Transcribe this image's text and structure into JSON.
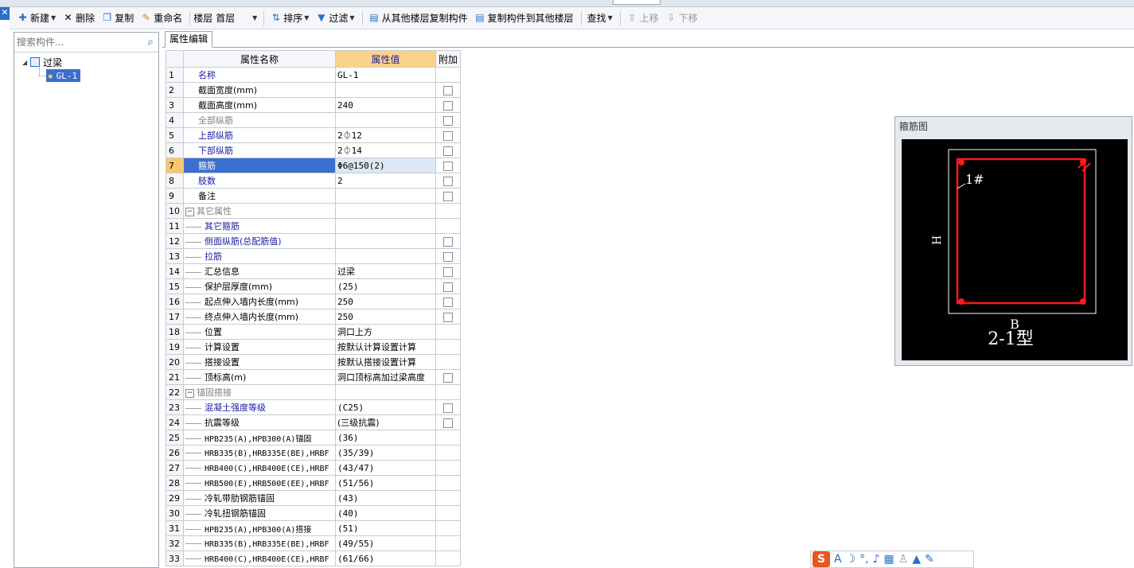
{
  "toolbar": {
    "new_label": "新建",
    "delete_label": "删除",
    "copy_label": "复制",
    "rename_label": "重命名",
    "floor_label": "楼层",
    "floor_value": "首层",
    "sort_label": "排序",
    "filter_label": "过滤",
    "copy_from_floor_label": "从其他楼层复制构件",
    "copy_to_floor_label": "复制构件到其他楼层",
    "find_label": "查找",
    "move_up_label": "上移",
    "move_down_label": "下移"
  },
  "tree": {
    "search_placeholder": "搜索构件...",
    "root_label": "过梁",
    "child_label": "GL-1"
  },
  "panel": {
    "tab_label": "属性编辑",
    "col_name": "属性名称",
    "col_value": "属性值",
    "col_extra": "附加"
  },
  "rows": [
    {
      "n": "1",
      "name": "名称",
      "value": "GL-1"
    },
    {
      "n": "2",
      "name": "截面宽度(mm)",
      "value": ""
    },
    {
      "n": "3",
      "name": "截面高度(mm)",
      "value": "240"
    },
    {
      "n": "4",
      "name": "全部纵筋",
      "value": ""
    },
    {
      "n": "5",
      "name": "上部纵筋",
      "value": "2⏀12"
    },
    {
      "n": "6",
      "name": "下部纵筋",
      "value": "2⏀14"
    },
    {
      "n": "7",
      "name": "箍筋",
      "value": "Φ6@150(2)"
    },
    {
      "n": "8",
      "name": "肢数",
      "value": "2"
    },
    {
      "n": "9",
      "name": "备注",
      "value": ""
    },
    {
      "n": "10",
      "name": "其它属性",
      "value": ""
    },
    {
      "n": "11",
      "name": "其它箍筋",
      "value": ""
    },
    {
      "n": "12",
      "name": "侧面纵筋(总配筋值)",
      "value": ""
    },
    {
      "n": "13",
      "name": "拉筋",
      "value": ""
    },
    {
      "n": "14",
      "name": "汇总信息",
      "value": "过梁"
    },
    {
      "n": "15",
      "name": "保护层厚度(mm)",
      "value": "(25)"
    },
    {
      "n": "16",
      "name": "起点伸入墙内长度(mm)",
      "value": "250"
    },
    {
      "n": "17",
      "name": "终点伸入墙内长度(mm)",
      "value": "250"
    },
    {
      "n": "18",
      "name": "位置",
      "value": "洞口上方"
    },
    {
      "n": "19",
      "name": "计算设置",
      "value": "按默认计算设置计算"
    },
    {
      "n": "20",
      "name": "搭接设置",
      "value": "按默认搭接设置计算"
    },
    {
      "n": "21",
      "name": "顶标高(m)",
      "value": "洞口顶标高加过梁高度"
    },
    {
      "n": "22",
      "name": "锚固搭接",
      "value": ""
    },
    {
      "n": "23",
      "name": "混凝土强度等级",
      "value": "(C25)"
    },
    {
      "n": "24",
      "name": "抗震等级",
      "value": "(三级抗震)"
    },
    {
      "n": "25",
      "name": "HPB235(A),HPB300(A)锚固",
      "value": "(36)"
    },
    {
      "n": "26",
      "name": "HRB335(B),HRB335E(BE),HRBF",
      "value": "(35/39)"
    },
    {
      "n": "27",
      "name": "HRB400(C),HRB400E(CE),HRBF",
      "value": "(43/47)"
    },
    {
      "n": "28",
      "name": "HRB500(E),HRB500E(EE),HRBF",
      "value": "(51/56)"
    },
    {
      "n": "29",
      "name": "冷轧带肋钢筋锚固",
      "value": "(43)"
    },
    {
      "n": "30",
      "name": "冷轧扭钢筋锚固",
      "value": "(40)"
    },
    {
      "n": "31",
      "name": "HPB235(A),HPB300(A)搭接",
      "value": "(51)"
    },
    {
      "n": "32",
      "name": "HRB335(B),HRB335E(BE),HRBF",
      "value": "(49/55)"
    },
    {
      "n": "33",
      "name": "HRB400(C),HRB400E(CE),HRBF",
      "value": "(61/66)"
    }
  ],
  "rebar_panel": {
    "title": "箍筋图",
    "label_1": "1#",
    "label_h": "H",
    "label_b": "B",
    "label_type": "2-1型"
  },
  "colors": {
    "selection": "#3b6fcf",
    "value_header": "#fbd28c",
    "blue_text": "#1a1aa0",
    "rebar_red": "#ff1a1a"
  }
}
